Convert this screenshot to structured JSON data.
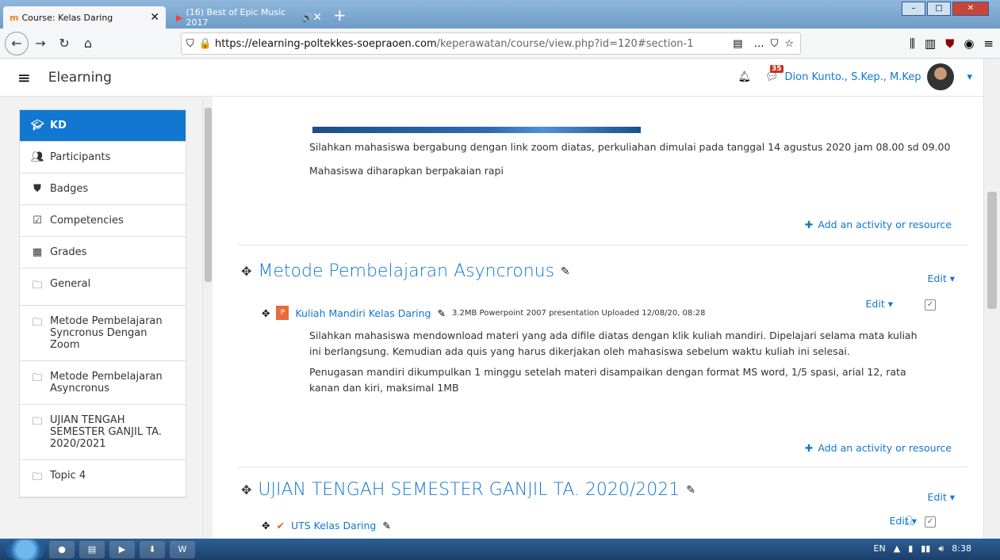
{
  "browser": {
    "tabs": [
      {
        "title": "Course: Kelas Daring",
        "active": true
      },
      {
        "title": "(16) Best of Epic Music 2017",
        "active": false
      }
    ],
    "url_domain": "https://elearning-poltekkes-soepraoen.com",
    "url_path": "/keperawatan/course/view.php?id=120#section-1"
  },
  "header": {
    "brand": "Elearning",
    "notification_count": "35",
    "user_name": "Dion Kunto., S.Kep., M.Kep"
  },
  "sidebar": {
    "items": [
      {
        "label": "KD",
        "icon": "graduation-cap-icon",
        "active": true
      },
      {
        "label": "Participants",
        "icon": "users-icon",
        "active": false
      },
      {
        "label": "Badges",
        "icon": "shield-icon",
        "active": false
      },
      {
        "label": "Competencies",
        "icon": "check-square-icon",
        "active": false
      },
      {
        "label": "Grades",
        "icon": "table-icon",
        "active": false
      },
      {
        "label": "General",
        "icon": "folder-icon",
        "active": false
      },
      {
        "label": "Metode Pembelajaran Syncronus Dengan Zoom",
        "icon": "folder-icon",
        "active": false
      },
      {
        "label": "Metode Pembelajaran Asyncronus",
        "icon": "folder-icon",
        "active": false
      },
      {
        "label": "UJIAN TENGAH SEMESTER GANJIL TA. 2020/2021",
        "icon": "folder-icon",
        "active": false
      },
      {
        "label": "Topic 4",
        "icon": "folder-icon",
        "active": false
      }
    ]
  },
  "main": {
    "section1": {
      "paragraph1": "Silahkan mahasiswa bergabung dengan link zoom diatas, perkuliahan dimulai pada tanggal 14 agustus 2020 jam 08.00 sd 09.00",
      "paragraph2": "Mahasiswa diharapkan berpakaian rapi",
      "add_label": "Add an activity or resource"
    },
    "section2": {
      "title": "Metode Pembelajaran Asyncronus",
      "edit_label": "Edit",
      "activity_name": "Kuliah Mandiri Kelas Daring",
      "activity_meta": "3.2MB Powerpoint 2007 presentation Uploaded 12/08/20, 08:28",
      "paragraph1": "Silahkan mahasiswa mendownload materi yang ada difile diatas dengan klik kuliah mandiri. Dipelajari selama mata kuliah ini berlangsung. Kemudian ada quis yang harus dikerjakan oleh mahasiswa sebelum waktu kuliah ini selesai.",
      "paragraph2": "Penugasan mandiri dikumpulkan 1 minggu setelah materi disampaikan dengan format MS word, 1/5 spasi, arial 12, rata kanan dan kiri, maksimal 1MB",
      "add_label": "Add an activity or resource"
    },
    "section3": {
      "title": "UJIAN TENGAH SEMESTER GANJIL TA. 2020/2021",
      "edit_label": "Edit",
      "activity_name": "UTS Kelas Daring"
    }
  },
  "taskbar": {
    "lang": "EN",
    "time": "8:38"
  }
}
